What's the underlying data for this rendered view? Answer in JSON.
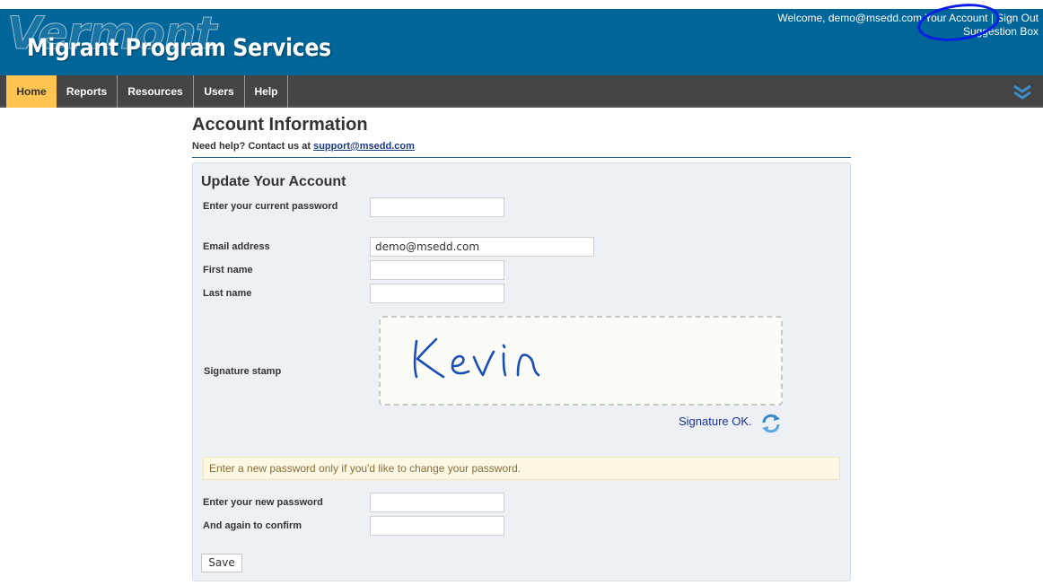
{
  "header": {
    "brand_state": "Vermont",
    "brand_name": "Migrant Program Services",
    "welcome": "Welcome, demo@msedd.com",
    "your_account": "Your Account",
    "separator": "|",
    "sign_out": "Sign Out",
    "suggestion_box": "Suggestion Box"
  },
  "nav": {
    "items": [
      {
        "label": "Home",
        "active": true
      },
      {
        "label": "Reports"
      },
      {
        "label": "Resources"
      },
      {
        "label": "Users"
      },
      {
        "label": "Help"
      }
    ],
    "menu_icon": "chevron-double-down-icon"
  },
  "page": {
    "title": "Account Information",
    "help_text": "Need help? Contact us at",
    "help_email": "support@msedd.com"
  },
  "form": {
    "title": "Update Your Account",
    "current_password_label": "Enter your current password",
    "current_password_value": "",
    "email_label": "Email address",
    "email_value": "demo@msedd.com",
    "first_name_label": "First name",
    "first_name_value": "",
    "last_name_label": "Last name",
    "last_name_value": "",
    "signature_label": "Signature stamp",
    "signature_text": "Kevin",
    "signature_status": "Signature OK.",
    "refresh_icon": "refresh-icon",
    "note": "Enter a new password only if you'd like to change your password.",
    "new_password_label": "Enter your new password",
    "new_password_value": "",
    "confirm_password_label": "And again to confirm",
    "confirm_password_value": "",
    "save_label": "Save"
  },
  "colors": {
    "header_bg": "#006599",
    "nav_bg": "#444444",
    "nav_active": "#ffc550",
    "panel_bg": "#edf1f6",
    "annotation": "#0a1de8"
  }
}
